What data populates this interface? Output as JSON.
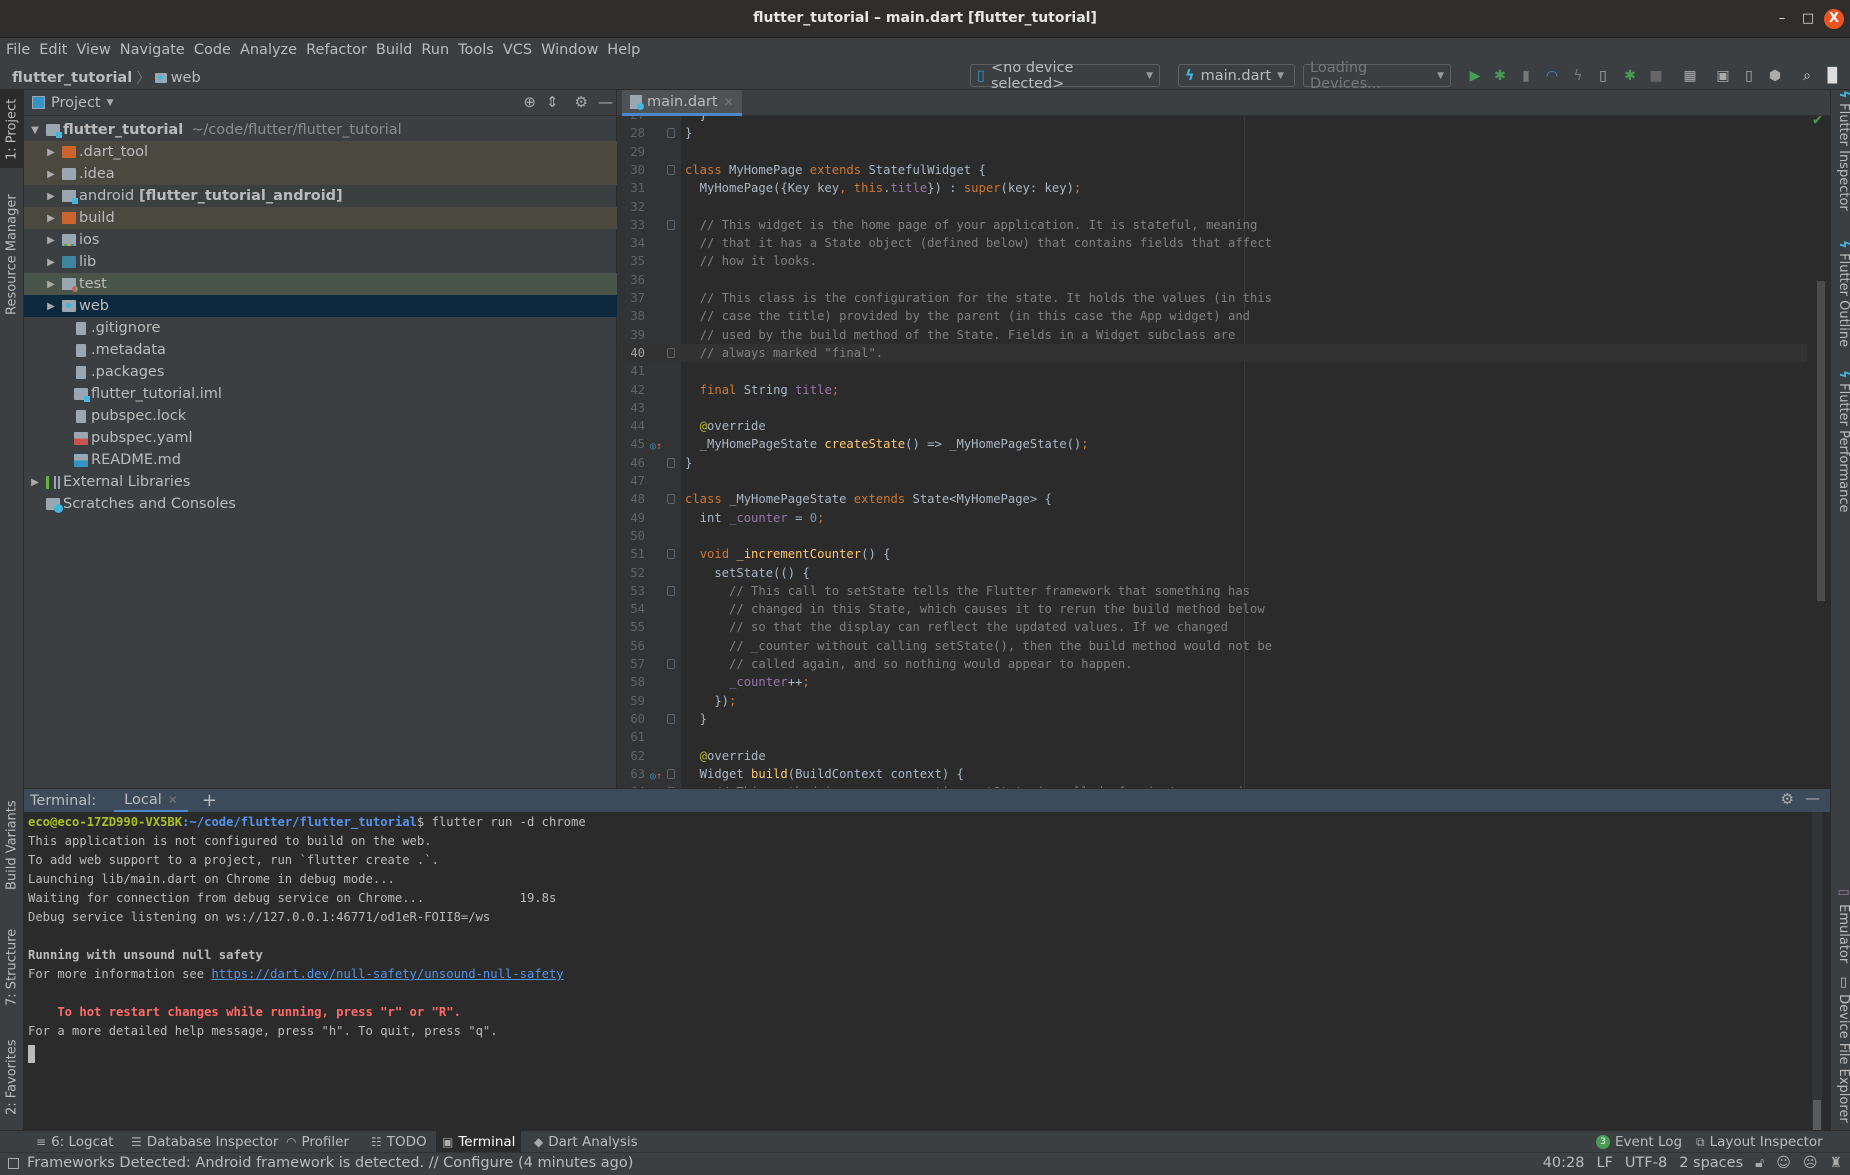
{
  "window": {
    "title": "flutter_tutorial – main.dart [flutter_tutorial]",
    "controls": {
      "minimize": "–",
      "maximize": "□",
      "close": "X"
    }
  },
  "menu": [
    "File",
    "Edit",
    "View",
    "Navigate",
    "Code",
    "Analyze",
    "Refactor",
    "Build",
    "Run",
    "Tools",
    "VCS",
    "Window",
    "Help"
  ],
  "breadcrumb": {
    "root": "flutter_tutorial",
    "separator": "〉",
    "child": "web"
  },
  "toolbar": {
    "device_selector": "<no device selected>",
    "run_config": "main.dart",
    "devices_loading": "Loading Devices...",
    "icons": [
      "run-icon",
      "debug-icon",
      "attach-debugger-icon",
      "profile-icon",
      "hot-reload-icon",
      "flutter-attach-icon",
      "apply-changes-icon",
      "stop-icon",
      "project-structure-icon",
      "sdk-manager-icon",
      "avd-manager-icon",
      "device-manager-icon",
      "search-icon",
      "user-icon"
    ]
  },
  "left_strip": {
    "top": [
      {
        "label": "1: Project",
        "active": true
      },
      {
        "label": "Resource Manager",
        "active": false
      }
    ],
    "bottom": [
      {
        "label": "Build Variants"
      },
      {
        "label": "7: Structure"
      },
      {
        "label": "2: Favorites"
      }
    ]
  },
  "right_strip": {
    "top": [
      "Flutter Inspector",
      "Flutter Outline",
      "Flutter Performance"
    ],
    "bottom": [
      "Emulator",
      "Device File Explorer"
    ]
  },
  "project_panel": {
    "title": "Project",
    "tree": [
      {
        "name": "flutter_tutorial",
        "suffix": "~/code/flutter/flutter_tutorial",
        "level": 0,
        "expanded": true,
        "icon": "module-folder",
        "bold": true
      },
      {
        "name": ".dart_tool",
        "level": 1,
        "expandable": true,
        "icon": "excluded-folder",
        "state": "excluded"
      },
      {
        "name": ".idea",
        "level": 1,
        "expandable": true,
        "icon": "config-folder",
        "state": "excluded"
      },
      {
        "name": "android",
        "suffix_bold": "[flutter_tutorial_android]",
        "level": 1,
        "expandable": true,
        "icon": "module-folder"
      },
      {
        "name": "build",
        "level": 1,
        "expandable": true,
        "icon": "excluded-folder",
        "state": "excluded"
      },
      {
        "name": "ios",
        "level": 1,
        "expandable": true,
        "icon": "ios-folder"
      },
      {
        "name": "lib",
        "level": 1,
        "expandable": true,
        "icon": "source-folder"
      },
      {
        "name": "test",
        "level": 1,
        "expandable": true,
        "icon": "test-folder",
        "state": "test"
      },
      {
        "name": "web",
        "level": 1,
        "expandable": true,
        "icon": "web-folder",
        "state": "selected"
      },
      {
        "name": ".gitignore",
        "level": 1,
        "icon": "file"
      },
      {
        "name": ".metadata",
        "level": 1,
        "icon": "file"
      },
      {
        "name": ".packages",
        "level": 1,
        "icon": "file"
      },
      {
        "name": "flutter_tutorial.iml",
        "level": 1,
        "icon": "module-file"
      },
      {
        "name": "pubspec.lock",
        "level": 1,
        "icon": "file"
      },
      {
        "name": "pubspec.yaml",
        "level": 1,
        "icon": "yaml-file"
      },
      {
        "name": "README.md",
        "level": 1,
        "icon": "markdown-file"
      },
      {
        "name": "External Libraries",
        "level": 0,
        "expandable": true,
        "icon": "libraries"
      },
      {
        "name": "Scratches and Consoles",
        "level": 0,
        "icon": "scratches"
      }
    ]
  },
  "editor": {
    "tab": "main.dart",
    "current_line": 40,
    "lines": [
      {
        "n": "27",
        "html": "  }"
      },
      {
        "n": "28",
        "html": "}"
      },
      {
        "n": "29",
        "html": ""
      },
      {
        "n": "30",
        "html": "<span class='kw'>class </span>MyHomePage <span class='kw'>extends </span>StatefulWidget {"
      },
      {
        "n": "31",
        "html": "  MyHomePage({Key key<span class='kw'>, this</span>.<span class='fld'>title</span>}) : <span class='kw'>super</span>(key: key)<span class='kw'>;</span>"
      },
      {
        "n": "32",
        "html": ""
      },
      {
        "n": "33",
        "html": "  <span class='cm'>// This widget is the home page of your application. It is stateful, meaning</span>"
      },
      {
        "n": "34",
        "html": "  <span class='cm'>// that it has a State object (defined below) that contains fields that affect</span>"
      },
      {
        "n": "35",
        "html": "  <span class='cm'>// how it looks.</span>"
      },
      {
        "n": "36",
        "html": ""
      },
      {
        "n": "37",
        "html": "  <span class='cm'>// This class is the configuration for the state. It holds the values (in this</span>"
      },
      {
        "n": "38",
        "html": "  <span class='cm'>// case the title) provided by the parent (in this case the App widget) and</span>"
      },
      {
        "n": "39",
        "html": "  <span class='cm'>// used by the build method of the State. Fields in a Widget subclass are</span>"
      },
      {
        "n": "40",
        "html": "  <span class='cm'>// always marked \"final\".</span>"
      },
      {
        "n": "41",
        "html": ""
      },
      {
        "n": "42",
        "html": "  <span class='kw'>final </span>String <span class='fld'>title</span><span class='kw'>;</span>"
      },
      {
        "n": "43",
        "html": ""
      },
      {
        "n": "44",
        "html": "  <span class='ann'>@</span>override"
      },
      {
        "n": "45",
        "html": "  _MyHomePageState <span class='fn'>createState</span>() => _MyHomePageState()<span class='kw'>;</span>"
      },
      {
        "n": "46",
        "html": "}"
      },
      {
        "n": "47",
        "html": ""
      },
      {
        "n": "48",
        "html": "<span class='kw'>class </span>_MyHomePageState <span class='kw'>extends </span>State&lt;MyHomePage&gt; {"
      },
      {
        "n": "49",
        "html": "  int <span class='fld'>_counter </span>= <span class='num'>0</span><span class='kw'>;</span>"
      },
      {
        "n": "50",
        "html": ""
      },
      {
        "n": "51",
        "html": "  <span class='kw'>void </span><span class='fn'>_incrementCounter</span>() {"
      },
      {
        "n": "52",
        "html": "    setState(() {"
      },
      {
        "n": "53",
        "html": "      <span class='cm'>// This call to setState tells the Flutter framework that something has</span>"
      },
      {
        "n": "54",
        "html": "      <span class='cm'>// changed in this State, which causes it to rerun the build method below</span>"
      },
      {
        "n": "55",
        "html": "      <span class='cm'>// so that the display can reflect the updated values. If we changed</span>"
      },
      {
        "n": "56",
        "html": "      <span class='cm'>// _counter without calling setState(), then the build method would not be</span>"
      },
      {
        "n": "57",
        "html": "      <span class='cm'>// called again, and so nothing would appear to happen.</span>"
      },
      {
        "n": "58",
        "html": "      <span class='fld'>_counter</span>++<span class='kw'>;</span>"
      },
      {
        "n": "59",
        "html": "    })<span class='kw'>;</span>"
      },
      {
        "n": "60",
        "html": "  }"
      },
      {
        "n": "61",
        "html": ""
      },
      {
        "n": "62",
        "html": "  <span class='ann'>@</span>override"
      },
      {
        "n": "63",
        "html": "  Widget <span class='fn'>build</span>(BuildContext context) {"
      },
      {
        "n": "64",
        "html": "    <span class='cm'>// This method is rerun every time setState is called, for instance as done</span>"
      }
    ],
    "override_markers": [
      "45",
      "63"
    ],
    "fold_markers": [
      "28",
      "30",
      "33",
      "40",
      "46",
      "48",
      "51",
      "53",
      "57",
      "60",
      "63",
      "64"
    ]
  },
  "terminal": {
    "label": "Terminal:",
    "tab": "Local",
    "add": "+",
    "prompt_user": "eco@eco-17ZD990-VX5BK",
    "prompt_path": ":~/code/flutter/flutter_tutorial",
    "prompt_symbol": "$ ",
    "command": "flutter run -d chrome",
    "lines": [
      "This application is not configured to build on the web.",
      "To add web support to a project, run `flutter create .`.",
      "Launching lib/main.dart on Chrome in debug mode...",
      "Waiting for connection from debug service on Chrome...             19.8s",
      "Debug service listening on ws://127.0.0.1:46771/od1eR-FOII8=/ws",
      ""
    ],
    "null_safety_heading": "Running with unsound null safety",
    "more_info_prefix": "For more information see ",
    "more_info_link": "https://dart.dev/null-safety/unsound-null-safety",
    "hot_restart": "    To hot restart changes while running, press \"r\" or \"R\".",
    "help_line": "For a more detailed help message, press \"h\". To quit, press \"q\"."
  },
  "bottom_tabs": [
    {
      "label": "6: Logcat",
      "icon": "logcat-icon",
      "active": false
    },
    {
      "label": "Database Inspector",
      "icon": "database-icon",
      "active": false
    },
    {
      "label": "Profiler",
      "icon": "profiler-icon",
      "active": false
    },
    {
      "label": "TODO",
      "icon": "todo-icon",
      "active": false
    },
    {
      "label": "Terminal",
      "icon": "terminal-icon",
      "active": true
    },
    {
      "label": "Dart Analysis",
      "icon": "dart-analysis-icon",
      "active": false
    }
  ],
  "bottom_tabs_right": [
    {
      "label": "Event Log",
      "badge": "3"
    },
    {
      "label": "Layout Inspector"
    }
  ],
  "status": {
    "message": "Frameworks Detected: Android framework is detected. // Configure (4 minutes ago)",
    "position": "40:28",
    "line_separator": "LF",
    "encoding": "UTF-8",
    "indent": "2 spaces"
  },
  "colors": {
    "accent": "#4a88c7",
    "selection": "#0d293e",
    "excluded_row": "#4b4840",
    "test_row": "#49544a",
    "close_button": "#e95420",
    "error_text": "#ff6b68",
    "link": "#5394ec"
  }
}
